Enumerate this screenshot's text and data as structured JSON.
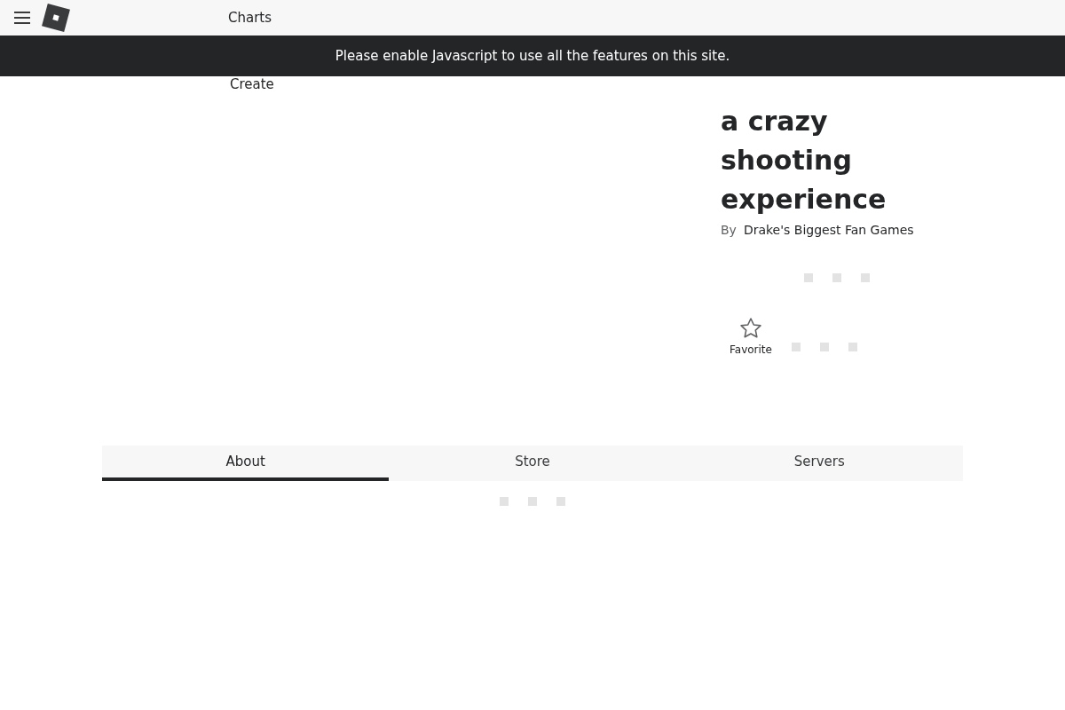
{
  "header": {
    "nav_links": [
      {
        "label": "Charts"
      },
      {
        "label": "Create"
      }
    ]
  },
  "banner": {
    "message": "Please enable Javascript to use all the features on this site."
  },
  "game": {
    "title": "a crazy shooting experience",
    "by_label": "By",
    "creator": "Drake's Biggest Fan Games",
    "favorite": {
      "label": "Favorite",
      "favorited": false
    }
  },
  "tabs": [
    {
      "label": "About",
      "selected": true
    },
    {
      "label": "Store",
      "selected": false
    },
    {
      "label": "Servers",
      "selected": false
    }
  ]
}
